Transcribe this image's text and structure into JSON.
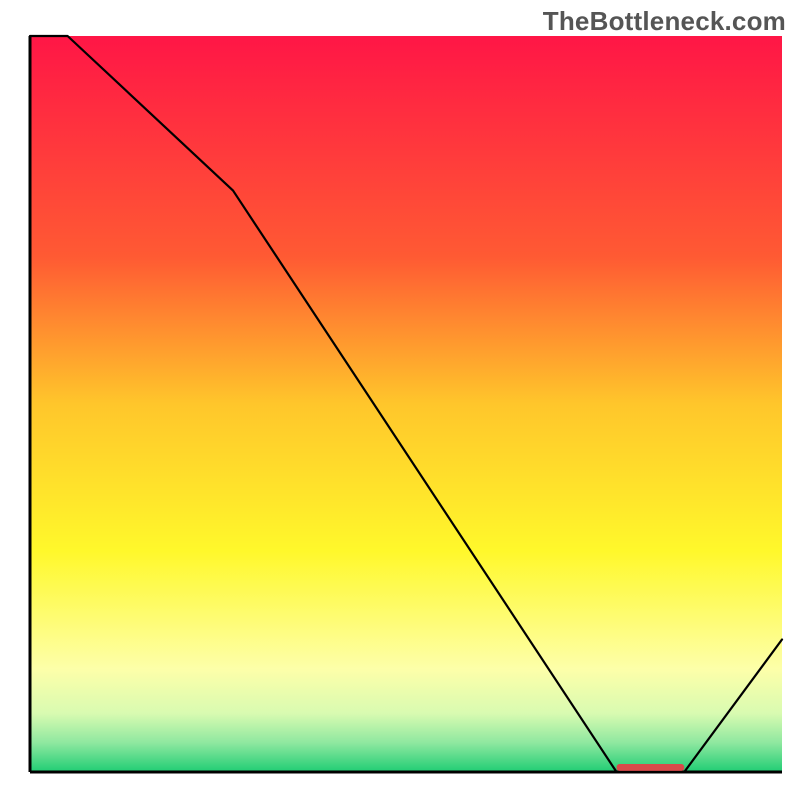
{
  "watermark": "TheBottleneck.com",
  "chart_data": {
    "type": "line",
    "title": "",
    "xlabel": "",
    "ylabel": "",
    "xlim": [
      0,
      100
    ],
    "ylim": [
      0,
      100
    ],
    "x": [
      0,
      5,
      27,
      78,
      80,
      87,
      100
    ],
    "values": [
      100,
      100,
      79,
      0,
      0,
      0,
      18
    ],
    "gradient_stops": [
      {
        "offset": 0.0,
        "color": "#ff1646"
      },
      {
        "offset": 0.3,
        "color": "#ff5a33"
      },
      {
        "offset": 0.5,
        "color": "#ffc62b"
      },
      {
        "offset": 0.7,
        "color": "#fff82b"
      },
      {
        "offset": 0.86,
        "color": "#fdffa9"
      },
      {
        "offset": 0.92,
        "color": "#d9fbb1"
      },
      {
        "offset": 0.96,
        "color": "#8fe8a0"
      },
      {
        "offset": 1.0,
        "color": "#20cd74"
      }
    ],
    "bottom_marker": {
      "x_start": 78,
      "x_end": 87,
      "color": "#d94a4a",
      "label": ""
    },
    "axis": {
      "color": "#000000",
      "width": 3
    },
    "line_style": {
      "color": "#000000",
      "width": 2.2
    }
  }
}
